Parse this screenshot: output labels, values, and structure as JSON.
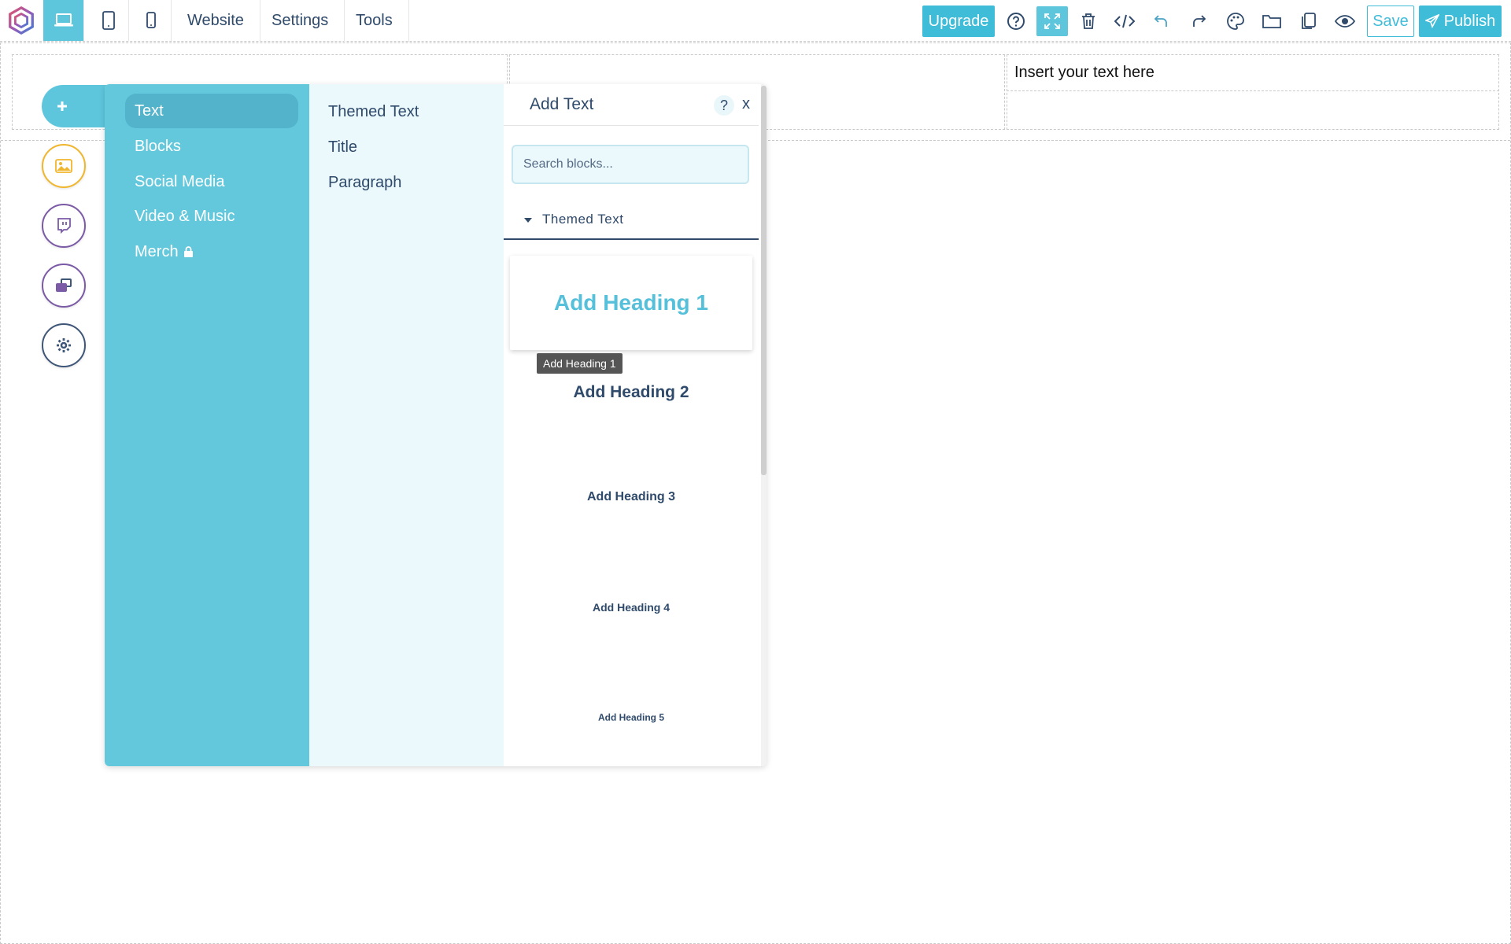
{
  "toolbar": {
    "devices": [
      {
        "name": "desktop",
        "icon": "laptop-icon",
        "active": true
      },
      {
        "name": "tablet",
        "icon": "tablet-icon",
        "active": false
      },
      {
        "name": "mobile",
        "icon": "phone-icon",
        "active": false
      }
    ],
    "menu": [
      "Website",
      "Settings",
      "Tools"
    ],
    "upgrade_label": "Upgrade",
    "tools": [
      "help-icon",
      "fullscreen-icon",
      "trash-icon",
      "code-icon",
      "undo-icon",
      "redo-icon",
      "palette-icon",
      "folder-icon",
      "copy-icon",
      "eye-icon"
    ],
    "save_label": "Save",
    "publish_label": "Publish"
  },
  "canvas": {
    "text_block": "Insert your text here"
  },
  "side_buttons": [
    "plus-icon",
    "image-icon",
    "twitch-icon",
    "layers-icon",
    "gear-icon"
  ],
  "panel": {
    "categories": [
      "Text",
      "Blocks",
      "Social Media",
      "Video & Music",
      "Merch"
    ],
    "active_category": "Text",
    "subitems": [
      "Themed Text",
      "Title",
      "Paragraph"
    ],
    "detail": {
      "title": "Add Text",
      "help": "?",
      "close": "x",
      "search_placeholder": "Search blocks...",
      "section": "Themed Text",
      "headings": [
        "Add Heading 1",
        "Add Heading 2",
        "Add Heading 3",
        "Add Heading 4",
        "Add Heading 5"
      ],
      "tooltip": "Add Heading 1"
    }
  },
  "colors": {
    "accent": "#3fbcd8",
    "panel_cat": "#64c8dc",
    "panel_sub": "#ecf9fc",
    "text_dark": "#2f4a6b",
    "image_ring": "#f0b62e",
    "purple_ring": "#7b5aa6",
    "gear_ring": "#3e5677"
  }
}
